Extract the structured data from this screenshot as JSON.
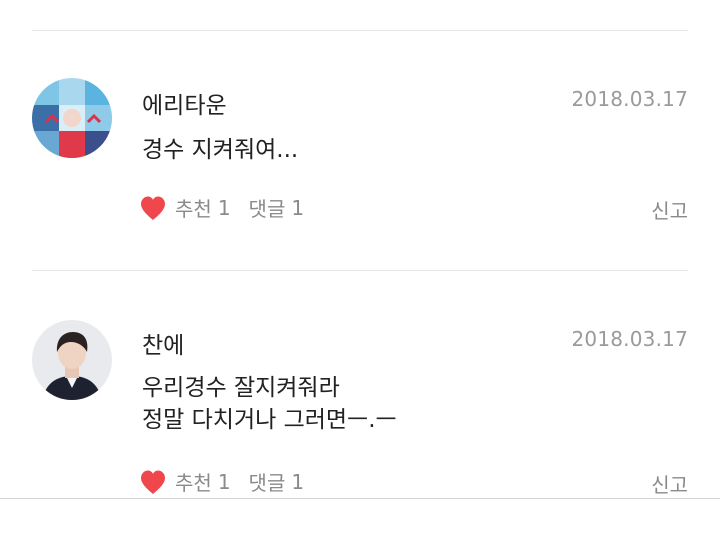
{
  "comments": [
    {
      "author": "에리타운",
      "date": "2018.03.17",
      "text": "경수 지켜줘여...",
      "like_label": "추천",
      "like_count": "1",
      "reply_label": "댓글",
      "reply_count": "1",
      "report_label": "신고",
      "avatar_icon": "profile-avatar-collage"
    },
    {
      "author": "찬에",
      "date": "2018.03.17",
      "text": "우리경수 잘지켜줘라\n정말 다치거나 그러면ㅡ.ㅡ",
      "like_label": "추천",
      "like_count": "1",
      "reply_label": "댓글",
      "reply_count": "1",
      "report_label": "신고",
      "avatar_icon": "profile-avatar-portrait"
    }
  ],
  "icons": {
    "like": "heart-icon"
  },
  "colors": {
    "accent": "#ff4646",
    "divider": "#e6e6e6",
    "meta": "#8a8a8a"
  }
}
